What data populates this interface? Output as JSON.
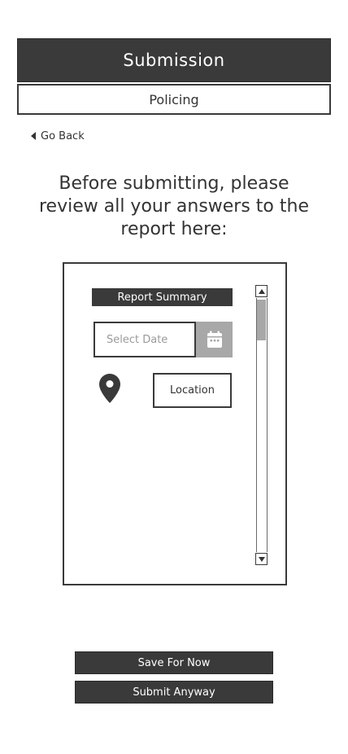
{
  "header": {
    "title": "Submission",
    "subtitle": "Policing"
  },
  "nav": {
    "go_back_label": "Go Back"
  },
  "instructions": {
    "text": "Before submitting, please review all your answers to the report here:"
  },
  "panel": {
    "summary_label": "Report Summary",
    "date_placeholder": "Select Date",
    "location_label": "Location",
    "scroll_position": 0.0
  },
  "actions": {
    "save_label": "Save For Now",
    "submit_label": "Submit Anyway"
  },
  "icons": {
    "back": "caret-left-icon",
    "calendar": "calendar-icon",
    "location": "map-pin-icon",
    "scroll_up": "scroll-up-arrow-icon",
    "scroll_down": "scroll-down-arrow-icon"
  },
  "colors": {
    "dark": "#3a3a3a",
    "accent_gray": "#a8a8a8",
    "background": "#ffffff"
  }
}
